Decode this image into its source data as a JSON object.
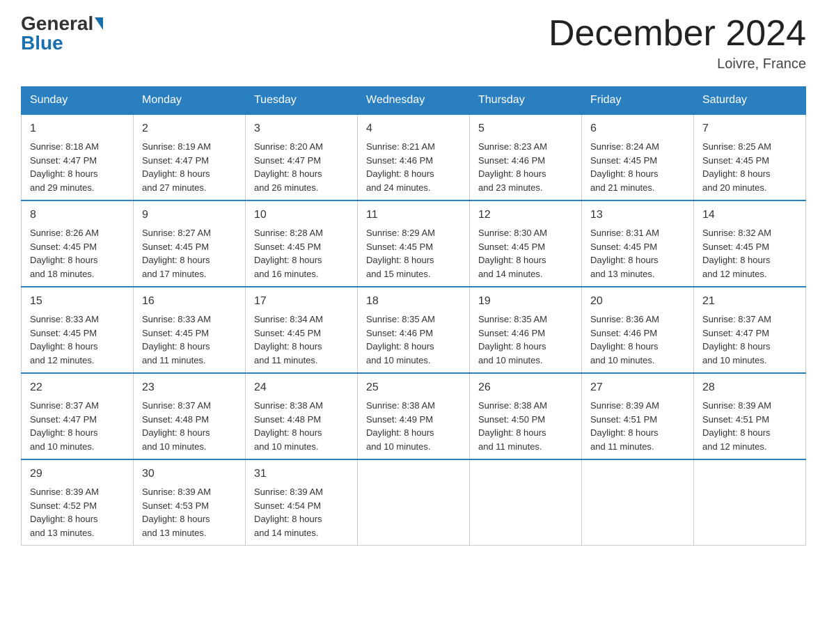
{
  "header": {
    "logo_general": "General",
    "logo_blue": "Blue",
    "month_title": "December 2024",
    "location": "Loivre, France"
  },
  "days_of_week": [
    "Sunday",
    "Monday",
    "Tuesday",
    "Wednesday",
    "Thursday",
    "Friday",
    "Saturday"
  ],
  "weeks": [
    [
      {
        "day": "1",
        "sunrise": "8:18 AM",
        "sunset": "4:47 PM",
        "daylight": "8 hours and 29 minutes."
      },
      {
        "day": "2",
        "sunrise": "8:19 AM",
        "sunset": "4:47 PM",
        "daylight": "8 hours and 27 minutes."
      },
      {
        "day": "3",
        "sunrise": "8:20 AM",
        "sunset": "4:47 PM",
        "daylight": "8 hours and 26 minutes."
      },
      {
        "day": "4",
        "sunrise": "8:21 AM",
        "sunset": "4:46 PM",
        "daylight": "8 hours and 24 minutes."
      },
      {
        "day": "5",
        "sunrise": "8:23 AM",
        "sunset": "4:46 PM",
        "daylight": "8 hours and 23 minutes."
      },
      {
        "day": "6",
        "sunrise": "8:24 AM",
        "sunset": "4:45 PM",
        "daylight": "8 hours and 21 minutes."
      },
      {
        "day": "7",
        "sunrise": "8:25 AM",
        "sunset": "4:45 PM",
        "daylight": "8 hours and 20 minutes."
      }
    ],
    [
      {
        "day": "8",
        "sunrise": "8:26 AM",
        "sunset": "4:45 PM",
        "daylight": "8 hours and 18 minutes."
      },
      {
        "day": "9",
        "sunrise": "8:27 AM",
        "sunset": "4:45 PM",
        "daylight": "8 hours and 17 minutes."
      },
      {
        "day": "10",
        "sunrise": "8:28 AM",
        "sunset": "4:45 PM",
        "daylight": "8 hours and 16 minutes."
      },
      {
        "day": "11",
        "sunrise": "8:29 AM",
        "sunset": "4:45 PM",
        "daylight": "8 hours and 15 minutes."
      },
      {
        "day": "12",
        "sunrise": "8:30 AM",
        "sunset": "4:45 PM",
        "daylight": "8 hours and 14 minutes."
      },
      {
        "day": "13",
        "sunrise": "8:31 AM",
        "sunset": "4:45 PM",
        "daylight": "8 hours and 13 minutes."
      },
      {
        "day": "14",
        "sunrise": "8:32 AM",
        "sunset": "4:45 PM",
        "daylight": "8 hours and 12 minutes."
      }
    ],
    [
      {
        "day": "15",
        "sunrise": "8:33 AM",
        "sunset": "4:45 PM",
        "daylight": "8 hours and 12 minutes."
      },
      {
        "day": "16",
        "sunrise": "8:33 AM",
        "sunset": "4:45 PM",
        "daylight": "8 hours and 11 minutes."
      },
      {
        "day": "17",
        "sunrise": "8:34 AM",
        "sunset": "4:45 PM",
        "daylight": "8 hours and 11 minutes."
      },
      {
        "day": "18",
        "sunrise": "8:35 AM",
        "sunset": "4:46 PM",
        "daylight": "8 hours and 10 minutes."
      },
      {
        "day": "19",
        "sunrise": "8:35 AM",
        "sunset": "4:46 PM",
        "daylight": "8 hours and 10 minutes."
      },
      {
        "day": "20",
        "sunrise": "8:36 AM",
        "sunset": "4:46 PM",
        "daylight": "8 hours and 10 minutes."
      },
      {
        "day": "21",
        "sunrise": "8:37 AM",
        "sunset": "4:47 PM",
        "daylight": "8 hours and 10 minutes."
      }
    ],
    [
      {
        "day": "22",
        "sunrise": "8:37 AM",
        "sunset": "4:47 PM",
        "daylight": "8 hours and 10 minutes."
      },
      {
        "day": "23",
        "sunrise": "8:37 AM",
        "sunset": "4:48 PM",
        "daylight": "8 hours and 10 minutes."
      },
      {
        "day": "24",
        "sunrise": "8:38 AM",
        "sunset": "4:48 PM",
        "daylight": "8 hours and 10 minutes."
      },
      {
        "day": "25",
        "sunrise": "8:38 AM",
        "sunset": "4:49 PM",
        "daylight": "8 hours and 10 minutes."
      },
      {
        "day": "26",
        "sunrise": "8:38 AM",
        "sunset": "4:50 PM",
        "daylight": "8 hours and 11 minutes."
      },
      {
        "day": "27",
        "sunrise": "8:39 AM",
        "sunset": "4:51 PM",
        "daylight": "8 hours and 11 minutes."
      },
      {
        "day": "28",
        "sunrise": "8:39 AM",
        "sunset": "4:51 PM",
        "daylight": "8 hours and 12 minutes."
      }
    ],
    [
      {
        "day": "29",
        "sunrise": "8:39 AM",
        "sunset": "4:52 PM",
        "daylight": "8 hours and 13 minutes."
      },
      {
        "day": "30",
        "sunrise": "8:39 AM",
        "sunset": "4:53 PM",
        "daylight": "8 hours and 13 minutes."
      },
      {
        "day": "31",
        "sunrise": "8:39 AM",
        "sunset": "4:54 PM",
        "daylight": "8 hours and 14 minutes."
      },
      null,
      null,
      null,
      null
    ]
  ],
  "labels": {
    "sunrise": "Sunrise:",
    "sunset": "Sunset:",
    "daylight": "Daylight:"
  }
}
